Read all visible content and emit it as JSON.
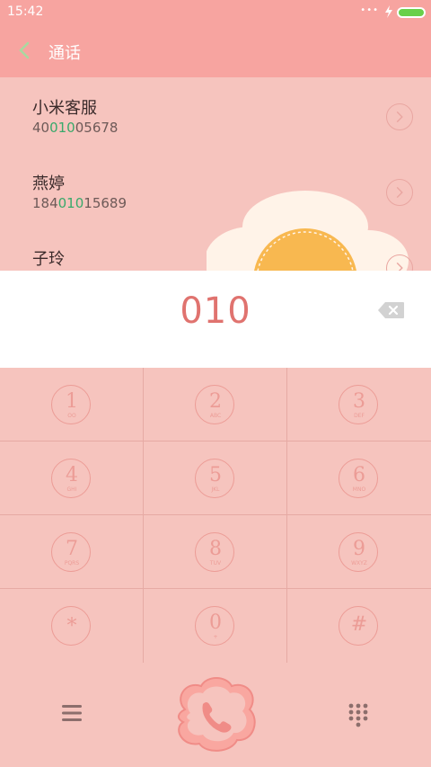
{
  "status_bar": {
    "time": "15:42",
    "dots": "•••"
  },
  "header": {
    "title": "通话"
  },
  "contacts": [
    {
      "name": "小米客服",
      "number_prefix": "40",
      "number_match": "010",
      "number_suffix": "05678"
    },
    {
      "name": "燕婷",
      "number_prefix": "184",
      "number_match": "010",
      "number_suffix": "15689"
    },
    {
      "name": "子玲"
    }
  ],
  "dialer": {
    "input_value": "010"
  },
  "keypad": {
    "keys": [
      {
        "digit": "1",
        "letters": "OO"
      },
      {
        "digit": "2",
        "letters": "ABC"
      },
      {
        "digit": "3",
        "letters": "DEF"
      },
      {
        "digit": "4",
        "letters": "GHI"
      },
      {
        "digit": "5",
        "letters": "JKL"
      },
      {
        "digit": "6",
        "letters": "MNO"
      },
      {
        "digit": "7",
        "letters": "PQRS"
      },
      {
        "digit": "8",
        "letters": "TUV"
      },
      {
        "digit": "9",
        "letters": "WXYZ"
      },
      {
        "digit": "*",
        "letters": ""
      },
      {
        "digit": "0",
        "letters": "+"
      },
      {
        "digit": "#",
        "letters": ""
      }
    ]
  },
  "colors": {
    "accent": "#f7a4a0",
    "background": "#f6c4be",
    "digits": "#e0736f",
    "highlight": "#39a96b",
    "battery": "#69d04a"
  },
  "icons": {
    "back": "chevron-left-icon",
    "delete": "backspace-icon",
    "menu": "hamburger-menu-icon",
    "call": "phone-icon",
    "dialpad": "dialpad-icon",
    "flower": "flower-decoration-icon"
  }
}
